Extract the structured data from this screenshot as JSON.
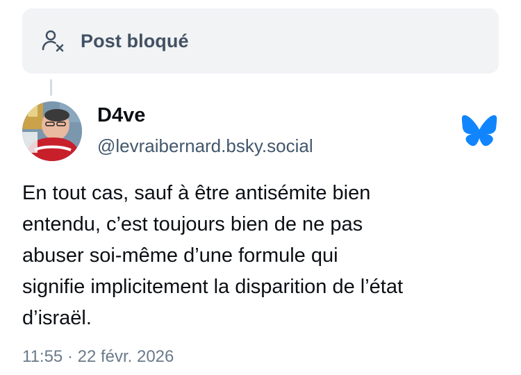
{
  "blocked_banner": {
    "icon": "person-blocked-icon",
    "label": "Post bloqué"
  },
  "author": {
    "display_name": "D4ve",
    "handle": "@levraibernard.bsky.social",
    "avatar": "avatar-image"
  },
  "platform_icon": "bluesky-butterfly-icon",
  "post": {
    "text": "En tout cas, sauf à être antisémite bien\nentendu, c’est toujours bien de ne pas\nabuser soi-même d’une formule qui\nsignifie implicitement la disparition de l’état\nd’israël.",
    "timestamp": "11:55 · 22 févr. 2026"
  },
  "colors": {
    "banner_bg": "#f1f3f5",
    "banner_text": "#425163",
    "bluesky_blue": "#1185fe",
    "handle_text": "#42576c",
    "timestamp_text": "#6a7a8b"
  }
}
